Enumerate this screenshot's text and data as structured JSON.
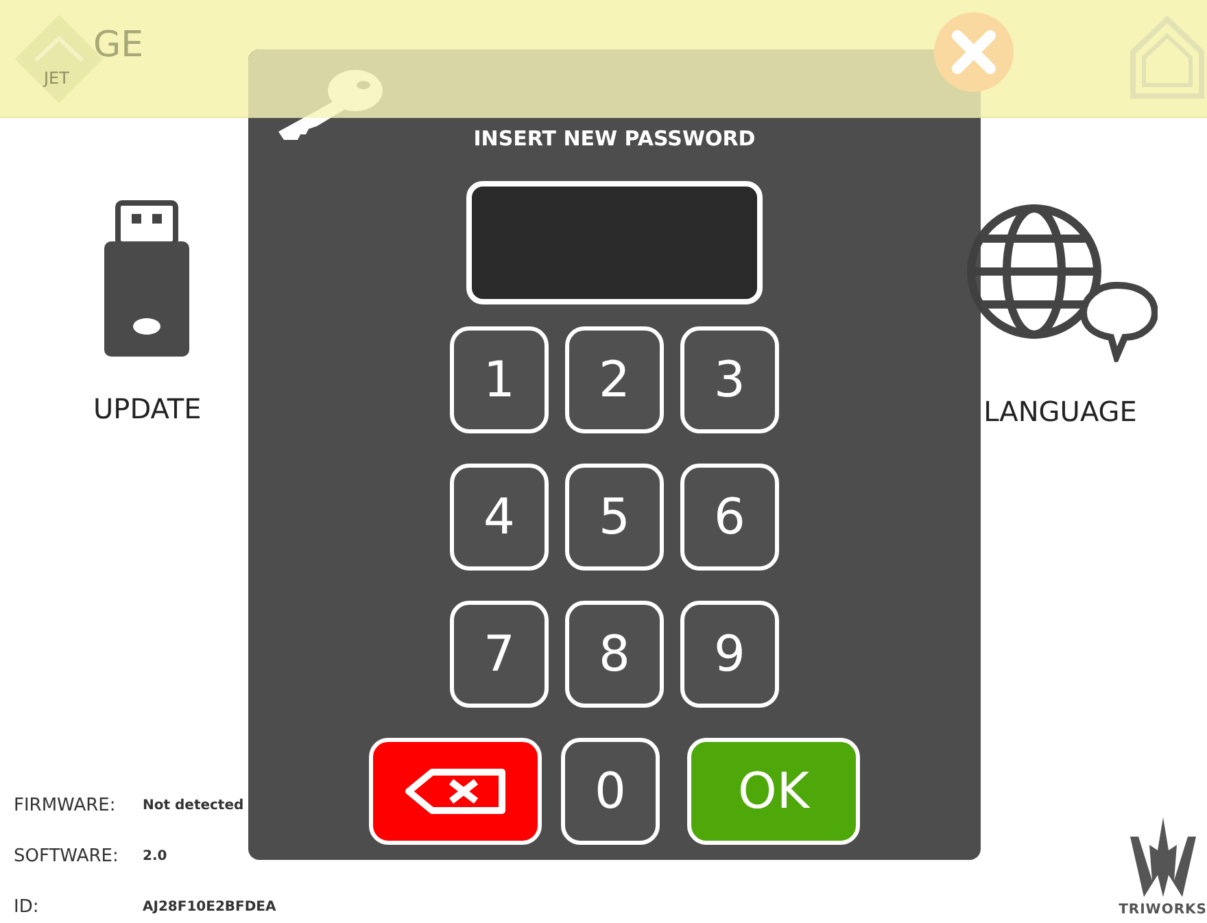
{
  "header": {
    "logo_text": "GE",
    "logo_subtext": "JET"
  },
  "menu_tiles": [
    {
      "kind": "usb",
      "label": "UPDATE"
    },
    {
      "kind": "globe",
      "label": "LANGUAGE"
    }
  ],
  "info": [
    {
      "label": "FIRMWARE:",
      "value": "Not detected"
    },
    {
      "label": "SOFTWARE:",
      "value": "2.0"
    },
    {
      "label": "ID:",
      "value": "AJ28F10E2BFDEA"
    }
  ],
  "brand": "TRIWORKS",
  "dialog": {
    "title": "INSERT NEW PASSWORD",
    "keypad_rows": [
      [
        {
          "kind": "digit",
          "label": "1"
        },
        {
          "kind": "digit",
          "label": "2"
        },
        {
          "kind": "digit",
          "label": "3"
        }
      ],
      [
        {
          "kind": "digit",
          "label": "4"
        },
        {
          "kind": "digit",
          "label": "5"
        },
        {
          "kind": "digit",
          "label": "6"
        }
      ],
      [
        {
          "kind": "digit",
          "label": "7"
        },
        {
          "kind": "digit",
          "label": "8"
        },
        {
          "kind": "digit",
          "label": "9"
        }
      ],
      [
        {
          "kind": "backspace"
        },
        {
          "kind": "digit",
          "label": "0"
        },
        {
          "kind": "ok",
          "label": "OK"
        }
      ]
    ]
  }
}
